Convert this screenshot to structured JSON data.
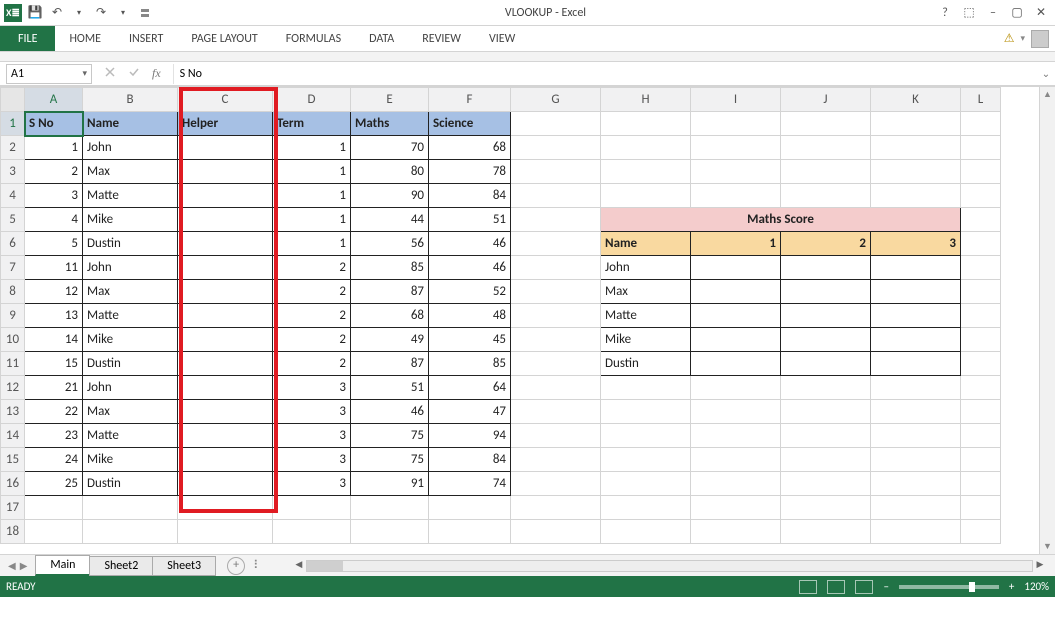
{
  "window": {
    "title": "VLOOKUP - Excel",
    "help": "?",
    "ribbon_opts": "⬚",
    "min": "–",
    "restore": "▢",
    "close": "✕"
  },
  "qat": {
    "app": "X≣",
    "save": "💾",
    "undo": "↶",
    "redo": "↷",
    "dd": "▾",
    "custom": "▾"
  },
  "tabs": {
    "file": "FILE",
    "home": "HOME",
    "insert": "INSERT",
    "page_layout": "PAGE LAYOUT",
    "formulas": "FORMULAS",
    "data": "DATA",
    "review": "REVIEW",
    "view": "VIEW"
  },
  "namebox": "A1",
  "formula": "S No",
  "columns": [
    "A",
    "B",
    "C",
    "D",
    "E",
    "F",
    "G",
    "H",
    "I",
    "J",
    "K",
    "L"
  ],
  "rows": [
    "1",
    "2",
    "3",
    "4",
    "5",
    "6",
    "7",
    "8",
    "9",
    "10",
    "11",
    "12",
    "13",
    "14",
    "15",
    "16",
    "17",
    "18"
  ],
  "table1": {
    "headers": [
      "S No",
      "Name",
      "Helper",
      "Term",
      "Maths",
      "Science"
    ],
    "rows": [
      {
        "sno": "1",
        "name": "John",
        "helper": "",
        "term": "1",
        "maths": "70",
        "science": "68"
      },
      {
        "sno": "2",
        "name": "Max",
        "helper": "",
        "term": "1",
        "maths": "80",
        "science": "78"
      },
      {
        "sno": "3",
        "name": "Matte",
        "helper": "",
        "term": "1",
        "maths": "90",
        "science": "84"
      },
      {
        "sno": "4",
        "name": "Mike",
        "helper": "",
        "term": "1",
        "maths": "44",
        "science": "51"
      },
      {
        "sno": "5",
        "name": "Dustin",
        "helper": "",
        "term": "1",
        "maths": "56",
        "science": "46"
      },
      {
        "sno": "11",
        "name": "John",
        "helper": "",
        "term": "2",
        "maths": "85",
        "science": "46"
      },
      {
        "sno": "12",
        "name": "Max",
        "helper": "",
        "term": "2",
        "maths": "87",
        "science": "52"
      },
      {
        "sno": "13",
        "name": "Matte",
        "helper": "",
        "term": "2",
        "maths": "68",
        "science": "48"
      },
      {
        "sno": "14",
        "name": "Mike",
        "helper": "",
        "term": "2",
        "maths": "49",
        "science": "45"
      },
      {
        "sno": "15",
        "name": "Dustin",
        "helper": "",
        "term": "2",
        "maths": "87",
        "science": "85"
      },
      {
        "sno": "21",
        "name": "John",
        "helper": "",
        "term": "3",
        "maths": "51",
        "science": "64"
      },
      {
        "sno": "22",
        "name": "Max",
        "helper": "",
        "term": "3",
        "maths": "46",
        "science": "47"
      },
      {
        "sno": "23",
        "name": "Matte",
        "helper": "",
        "term": "3",
        "maths": "75",
        "science": "94"
      },
      {
        "sno": "24",
        "name": "Mike",
        "helper": "",
        "term": "3",
        "maths": "75",
        "science": "84"
      },
      {
        "sno": "25",
        "name": "Dustin",
        "helper": "",
        "term": "3",
        "maths": "91",
        "science": "74"
      }
    ]
  },
  "table2": {
    "title": "Maths Score",
    "hdr_name": "Name",
    "hdr_1": "1",
    "hdr_2": "2",
    "hdr_3": "3",
    "names": [
      "John",
      "Max",
      "Matte",
      "Mike",
      "Dustin"
    ]
  },
  "sheets": {
    "main": "Main",
    "s2": "Sheet2",
    "s3": "Sheet3"
  },
  "status": {
    "ready": "READY",
    "zoom": "120%"
  }
}
